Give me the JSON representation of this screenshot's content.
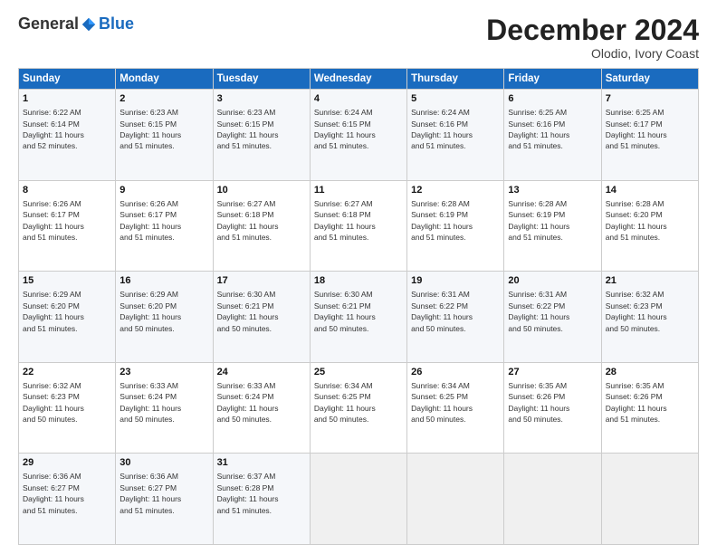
{
  "logo": {
    "general": "General",
    "blue": "Blue"
  },
  "header": {
    "month": "December 2024",
    "location": "Olodio, Ivory Coast"
  },
  "weekdays": [
    "Sunday",
    "Monday",
    "Tuesday",
    "Wednesday",
    "Thursday",
    "Friday",
    "Saturday"
  ],
  "weeks": [
    [
      {
        "day": "1",
        "info": "Sunrise: 6:22 AM\nSunset: 6:14 PM\nDaylight: 11 hours\nand 52 minutes."
      },
      {
        "day": "2",
        "info": "Sunrise: 6:23 AM\nSunset: 6:15 PM\nDaylight: 11 hours\nand 51 minutes."
      },
      {
        "day": "3",
        "info": "Sunrise: 6:23 AM\nSunset: 6:15 PM\nDaylight: 11 hours\nand 51 minutes."
      },
      {
        "day": "4",
        "info": "Sunrise: 6:24 AM\nSunset: 6:15 PM\nDaylight: 11 hours\nand 51 minutes."
      },
      {
        "day": "5",
        "info": "Sunrise: 6:24 AM\nSunset: 6:16 PM\nDaylight: 11 hours\nand 51 minutes."
      },
      {
        "day": "6",
        "info": "Sunrise: 6:25 AM\nSunset: 6:16 PM\nDaylight: 11 hours\nand 51 minutes."
      },
      {
        "day": "7",
        "info": "Sunrise: 6:25 AM\nSunset: 6:17 PM\nDaylight: 11 hours\nand 51 minutes."
      }
    ],
    [
      {
        "day": "8",
        "info": "Sunrise: 6:26 AM\nSunset: 6:17 PM\nDaylight: 11 hours\nand 51 minutes."
      },
      {
        "day": "9",
        "info": "Sunrise: 6:26 AM\nSunset: 6:17 PM\nDaylight: 11 hours\nand 51 minutes."
      },
      {
        "day": "10",
        "info": "Sunrise: 6:27 AM\nSunset: 6:18 PM\nDaylight: 11 hours\nand 51 minutes."
      },
      {
        "day": "11",
        "info": "Sunrise: 6:27 AM\nSunset: 6:18 PM\nDaylight: 11 hours\nand 51 minutes."
      },
      {
        "day": "12",
        "info": "Sunrise: 6:28 AM\nSunset: 6:19 PM\nDaylight: 11 hours\nand 51 minutes."
      },
      {
        "day": "13",
        "info": "Sunrise: 6:28 AM\nSunset: 6:19 PM\nDaylight: 11 hours\nand 51 minutes."
      },
      {
        "day": "14",
        "info": "Sunrise: 6:28 AM\nSunset: 6:20 PM\nDaylight: 11 hours\nand 51 minutes."
      }
    ],
    [
      {
        "day": "15",
        "info": "Sunrise: 6:29 AM\nSunset: 6:20 PM\nDaylight: 11 hours\nand 51 minutes."
      },
      {
        "day": "16",
        "info": "Sunrise: 6:29 AM\nSunset: 6:20 PM\nDaylight: 11 hours\nand 50 minutes."
      },
      {
        "day": "17",
        "info": "Sunrise: 6:30 AM\nSunset: 6:21 PM\nDaylight: 11 hours\nand 50 minutes."
      },
      {
        "day": "18",
        "info": "Sunrise: 6:30 AM\nSunset: 6:21 PM\nDaylight: 11 hours\nand 50 minutes."
      },
      {
        "day": "19",
        "info": "Sunrise: 6:31 AM\nSunset: 6:22 PM\nDaylight: 11 hours\nand 50 minutes."
      },
      {
        "day": "20",
        "info": "Sunrise: 6:31 AM\nSunset: 6:22 PM\nDaylight: 11 hours\nand 50 minutes."
      },
      {
        "day": "21",
        "info": "Sunrise: 6:32 AM\nSunset: 6:23 PM\nDaylight: 11 hours\nand 50 minutes."
      }
    ],
    [
      {
        "day": "22",
        "info": "Sunrise: 6:32 AM\nSunset: 6:23 PM\nDaylight: 11 hours\nand 50 minutes."
      },
      {
        "day": "23",
        "info": "Sunrise: 6:33 AM\nSunset: 6:24 PM\nDaylight: 11 hours\nand 50 minutes."
      },
      {
        "day": "24",
        "info": "Sunrise: 6:33 AM\nSunset: 6:24 PM\nDaylight: 11 hours\nand 50 minutes."
      },
      {
        "day": "25",
        "info": "Sunrise: 6:34 AM\nSunset: 6:25 PM\nDaylight: 11 hours\nand 50 minutes."
      },
      {
        "day": "26",
        "info": "Sunrise: 6:34 AM\nSunset: 6:25 PM\nDaylight: 11 hours\nand 50 minutes."
      },
      {
        "day": "27",
        "info": "Sunrise: 6:35 AM\nSunset: 6:26 PM\nDaylight: 11 hours\nand 50 minutes."
      },
      {
        "day": "28",
        "info": "Sunrise: 6:35 AM\nSunset: 6:26 PM\nDaylight: 11 hours\nand 51 minutes."
      }
    ],
    [
      {
        "day": "29",
        "info": "Sunrise: 6:36 AM\nSunset: 6:27 PM\nDaylight: 11 hours\nand 51 minutes."
      },
      {
        "day": "30",
        "info": "Sunrise: 6:36 AM\nSunset: 6:27 PM\nDaylight: 11 hours\nand 51 minutes."
      },
      {
        "day": "31",
        "info": "Sunrise: 6:37 AM\nSunset: 6:28 PM\nDaylight: 11 hours\nand 51 minutes."
      },
      null,
      null,
      null,
      null
    ]
  ]
}
